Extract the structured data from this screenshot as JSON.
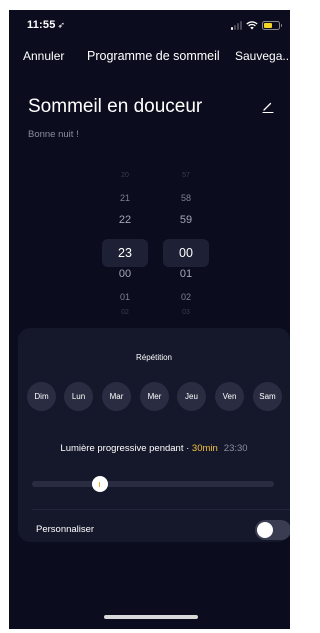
{
  "status_bar": {
    "time": "11:55",
    "signal_bars_active": 1,
    "battery_color": "#f5d524"
  },
  "nav": {
    "cancel_label": "Annuler",
    "title": "Programme de sommeil",
    "save_label": "Sauvega..."
  },
  "program": {
    "name": "Sommeil en douceur",
    "subtitle": "Bonne nuit !"
  },
  "picker": {
    "hours": [
      "20",
      "21",
      "22",
      "23",
      "00",
      "01",
      "02"
    ],
    "minutes": [
      "57",
      "58",
      "59",
      "00",
      "01",
      "02",
      "03"
    ],
    "selected_hour": "23",
    "selected_minute": "00"
  },
  "repetition": {
    "label": "Répétition",
    "days": [
      "Dim",
      "Lun",
      "Mar",
      "Mer",
      "Jeu",
      "Ven",
      "Sam"
    ]
  },
  "progressive_light": {
    "label": "Lumière progressive pendant · ",
    "duration": "30min",
    "end_time": "23:30",
    "level_fraction": 0.28
  },
  "customize": {
    "label": "Personnaliser",
    "enabled": false
  },
  "colors": {
    "background": "#0b0d1e",
    "card": "#15182b",
    "accent": "#f5c141"
  }
}
